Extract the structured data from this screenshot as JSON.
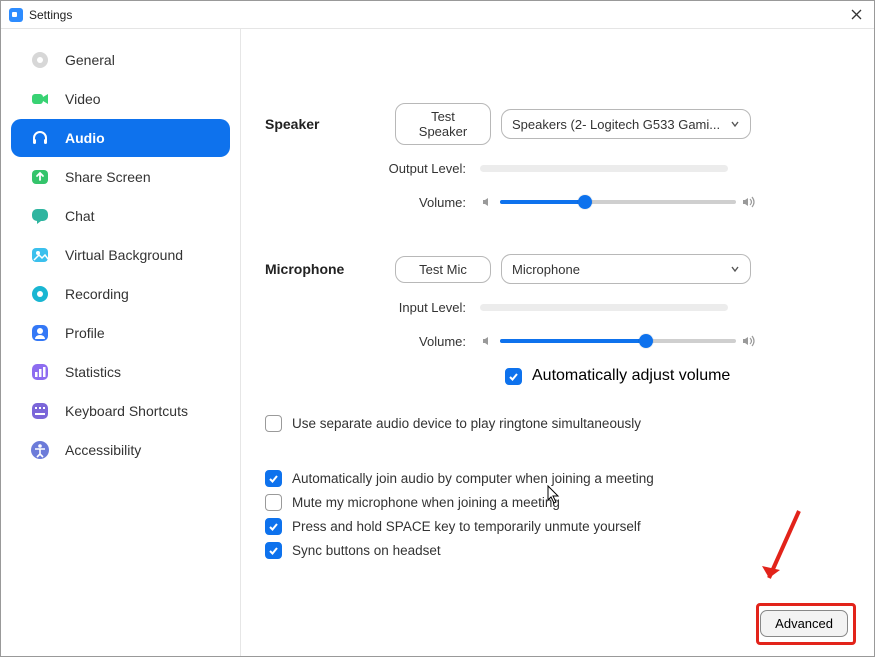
{
  "window": {
    "title": "Settings"
  },
  "sidebar": {
    "items": [
      {
        "label": "General"
      },
      {
        "label": "Video"
      },
      {
        "label": "Audio"
      },
      {
        "label": "Share Screen"
      },
      {
        "label": "Chat"
      },
      {
        "label": "Virtual Background"
      },
      {
        "label": "Recording"
      },
      {
        "label": "Profile"
      },
      {
        "label": "Statistics"
      },
      {
        "label": "Keyboard Shortcuts"
      },
      {
        "label": "Accessibility"
      }
    ],
    "active_index": 2
  },
  "speaker": {
    "section": "Speaker",
    "test_btn": "Test Speaker",
    "device": "Speakers (2- Logitech G533 Gami...",
    "output_label": "Output Level:",
    "volume_label": "Volume:",
    "volume_pct": 36
  },
  "microphone": {
    "section": "Microphone",
    "test_btn": "Test Mic",
    "device": "Microphone",
    "input_label": "Input Level:",
    "volume_label": "Volume:",
    "volume_pct": 62,
    "auto_adjust": "Automatically adjust volume"
  },
  "options": {
    "ringtone": "Use separate audio device to play ringtone simultaneously",
    "auto_join": "Automatically join audio by computer when joining a meeting",
    "mute_join": "Mute my microphone when joining a meeting",
    "space_unmute": "Press and hold SPACE key to temporarily unmute yourself",
    "sync_headset": "Sync buttons on headset"
  },
  "advanced_btn": "Advanced",
  "checks": {
    "ringtone": false,
    "auto_join": true,
    "mute_join": false,
    "space_unmute": true,
    "sync_headset": true,
    "auto_adjust": true
  }
}
